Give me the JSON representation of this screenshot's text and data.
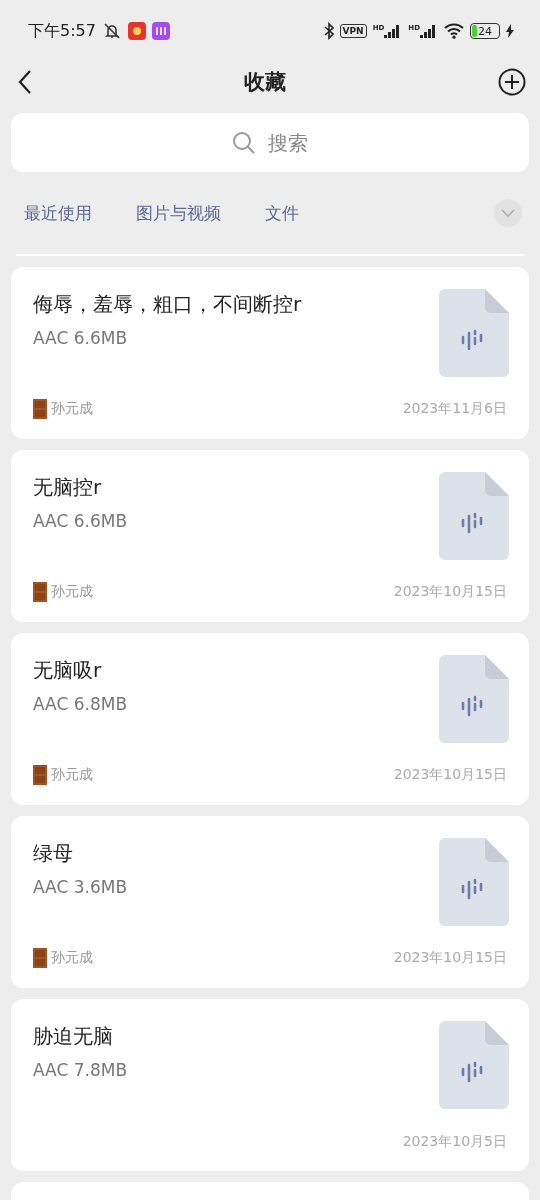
{
  "status_bar": {
    "time": "下午5:57",
    "vpn": "VPN",
    "signal_labels": [
      "HD",
      "HD"
    ],
    "battery": "24"
  },
  "header": {
    "title": "收藏"
  },
  "search": {
    "placeholder": "搜索"
  },
  "tabs": [
    {
      "label": "最近使用"
    },
    {
      "label": "图片与视频"
    },
    {
      "label": "文件"
    }
  ],
  "items": [
    {
      "title": "侮辱，羞辱，粗口，不间断控r",
      "meta": "AAC 6.6MB",
      "source": "孙元成",
      "date": "2023年11月6日"
    },
    {
      "title": "无脑控r",
      "meta": "AAC 6.6MB",
      "source": "孙元成",
      "date": "2023年10月15日"
    },
    {
      "title": "无脑吸r",
      "meta": "AAC 6.8MB",
      "source": "孙元成",
      "date": "2023年10月15日"
    },
    {
      "title": "绿母",
      "meta": "AAC 3.6MB",
      "source": "孙元成",
      "date": "2023年10月15日"
    },
    {
      "title": "胁迫无脑",
      "meta": "AAC 7.8MB",
      "date": "2023年10月5日"
    }
  ]
}
